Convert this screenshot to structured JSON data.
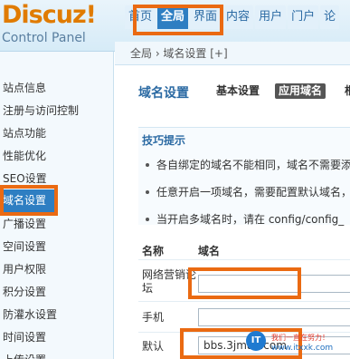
{
  "header": {
    "logo_title": "Discuz!",
    "logo_subtitle": "Control Panel",
    "nav": [
      {
        "label": "首页"
      },
      {
        "label": "全局"
      },
      {
        "label": "界面"
      },
      {
        "label": "内容"
      },
      {
        "label": "用户"
      },
      {
        "label": "门户"
      },
      {
        "label": "论"
      }
    ]
  },
  "breadcrumb": "全局 › 域名设置 [+]",
  "sidebar": {
    "items": [
      {
        "label": "站点信息"
      },
      {
        "label": "注册与访问控制"
      },
      {
        "label": "站点功能"
      },
      {
        "label": "性能优化"
      },
      {
        "label": "SEO设置"
      },
      {
        "label": "域名设置"
      },
      {
        "label": "广播设置"
      },
      {
        "label": "空间设置"
      },
      {
        "label": "用户权限"
      },
      {
        "label": "积分设置"
      },
      {
        "label": "防灌水设置"
      },
      {
        "label": "时间设置"
      },
      {
        "label": "上传设置"
      }
    ]
  },
  "main": {
    "title": "域名设置",
    "tabs": [
      {
        "label": "基本设置"
      },
      {
        "label": "应用域名"
      },
      {
        "label": "根"
      }
    ],
    "tips": {
      "title": "技巧提示",
      "items": [
        "各自绑定的域名不能相同，域名不需要添",
        "任意开启一项域名，需要配置默认域名，",
        "当开启多域名时，请在 config/config_"
      ]
    },
    "table": {
      "col_name": "名称",
      "col_domain": "域名",
      "rows": [
        {
          "label": "网络营销论坛",
          "value": ""
        },
        {
          "label": "手机",
          "value": ""
        },
        {
          "label": "默认",
          "value": "bbs.3jmao.com"
        }
      ]
    }
  },
  "watermark": {
    "badge": "IT",
    "line1": "我们一直在努力！",
    "line2": "www.itxxk.com"
  }
}
